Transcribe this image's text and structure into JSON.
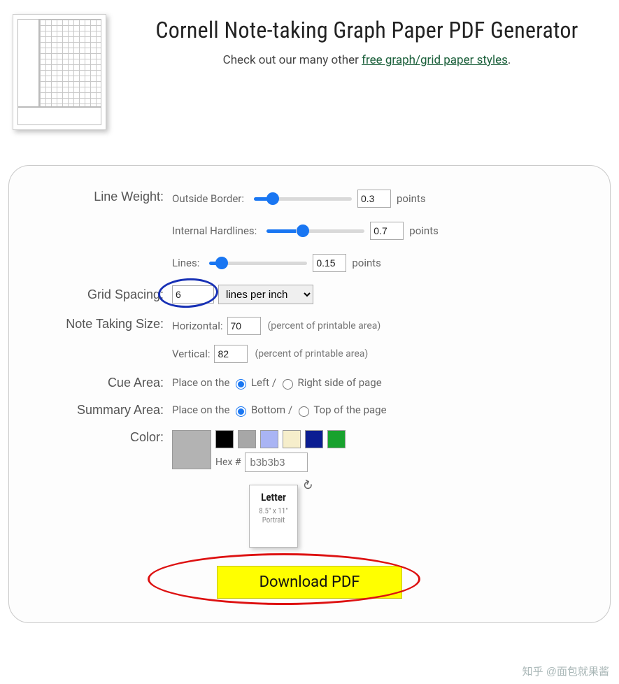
{
  "header": {
    "title": "Cornell Note-taking Graph Paper PDF Generator",
    "subtitle_prefix": "Check out our many other ",
    "subtitle_link": "free graph/grid paper styles",
    "subtitle_suffix": "."
  },
  "form": {
    "line_weight": {
      "label": "Line Weight:",
      "outside": {
        "label": "Outside Border:",
        "value": "0.3",
        "unit": "points"
      },
      "internal": {
        "label": "Internal Hardlines:",
        "value": "0.7",
        "unit": "points"
      },
      "lines": {
        "label": "Lines:",
        "value": "0.15",
        "unit": "points"
      }
    },
    "grid_spacing": {
      "label": "Grid Spacing:",
      "value": "6",
      "unit_select": "lines per inch"
    },
    "note_size": {
      "label": "Note Taking Size:",
      "horizontal": {
        "label": "Horizontal:",
        "value": "70",
        "hint": "(percent of printable area)"
      },
      "vertical": {
        "label": "Vertical:",
        "value": "82",
        "hint": "(percent of printable area)"
      }
    },
    "cue_area": {
      "label": "Cue Area:",
      "prefix": "Place on the ",
      "left": "Left",
      "sep": " / ",
      "right": "Right side of page",
      "selected": "left"
    },
    "summary_area": {
      "label": "Summary Area:",
      "prefix": "Place on the ",
      "bottom": "Bottom",
      "sep": " / ",
      "top": "Top of the page",
      "selected": "bottom"
    },
    "color": {
      "label": "Color:",
      "selected_hex": "b3b3b3",
      "hex_label": "Hex #",
      "swatches": [
        "#000000",
        "#a7a7a7",
        "#a9b4f4",
        "#f6eecb",
        "#0b1d92",
        "#18a22e"
      ]
    },
    "paper": {
      "name": "Letter",
      "dims": "8.5\" x 11\"",
      "orientation": "Portrait"
    },
    "download_label": "Download PDF"
  },
  "watermark": "知乎 @面包就果酱"
}
